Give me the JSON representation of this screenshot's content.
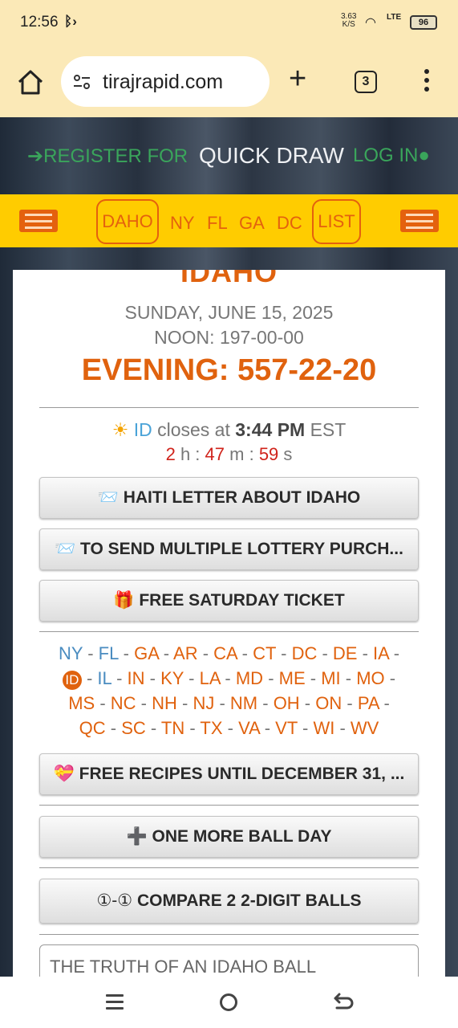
{
  "status_bar": {
    "time": "12:56",
    "net_speed": "3.63",
    "net_unit": "K/S",
    "network": "LTE",
    "battery": "96"
  },
  "browser": {
    "url": "tirajrapid.com",
    "tab_count": "3"
  },
  "top_nav": {
    "register": "REGISTER FOR",
    "title": "QUICK DRAW",
    "login": "LOG IN"
  },
  "state_tabs": {
    "active": "DAHO",
    "items": [
      "NY",
      "FL",
      "GA",
      "DC"
    ],
    "list": "LIST"
  },
  "results": {
    "title": "IDAHO",
    "date": "SUNDAY, JUNE 15, 2025",
    "noon": "NOON: 197-00-00",
    "evening": "EVENING: 557-22-20"
  },
  "closing": {
    "state": "ID",
    "text": "closes at",
    "time": "3:44",
    "ampm": "PM",
    "tz": "EST",
    "hours": "2",
    "hours_unit": "h",
    "minutes": "47",
    "minutes_unit": "m",
    "seconds": "59",
    "seconds_unit": "s"
  },
  "buttons": {
    "letter": "HAITI LETTER ABOUT IDAHO",
    "multiple": "TO SEND MULTIPLE LOTTERY PURCH...",
    "saturday": "FREE SATURDAY TICKET",
    "recipes": "FREE RECIPES UNTIL DECEMBER 31, ...",
    "one_more": "ONE MORE BALL DAY",
    "compare": "COMPARE 2 2-DIGIT BALLS"
  },
  "states_list": {
    "row1": [
      "NY",
      "FL",
      "GA",
      "AR",
      "CA",
      "CT",
      "DC",
      "DE",
      "IA"
    ],
    "current": "ID",
    "row2": [
      "IL",
      "IN",
      "KY",
      "LA",
      "MD",
      "ME",
      "MI",
      "MO"
    ],
    "row3": [
      "MS",
      "NC",
      "NH",
      "NJ",
      "NM",
      "OH",
      "ON",
      "PA"
    ],
    "row4": [
      "QC",
      "SC",
      "TN",
      "TX",
      "VA",
      "VT",
      "WI",
      "WV"
    ]
  },
  "truth_field": {
    "placeholder": "THE TRUTH OF AN IDAHO BALL"
  },
  "colors": {
    "accent_orange": "#e0620e",
    "yellow_bar": "#ffcc00",
    "green_link": "#3aa55b",
    "browser_bg": "#fbe9b7"
  }
}
